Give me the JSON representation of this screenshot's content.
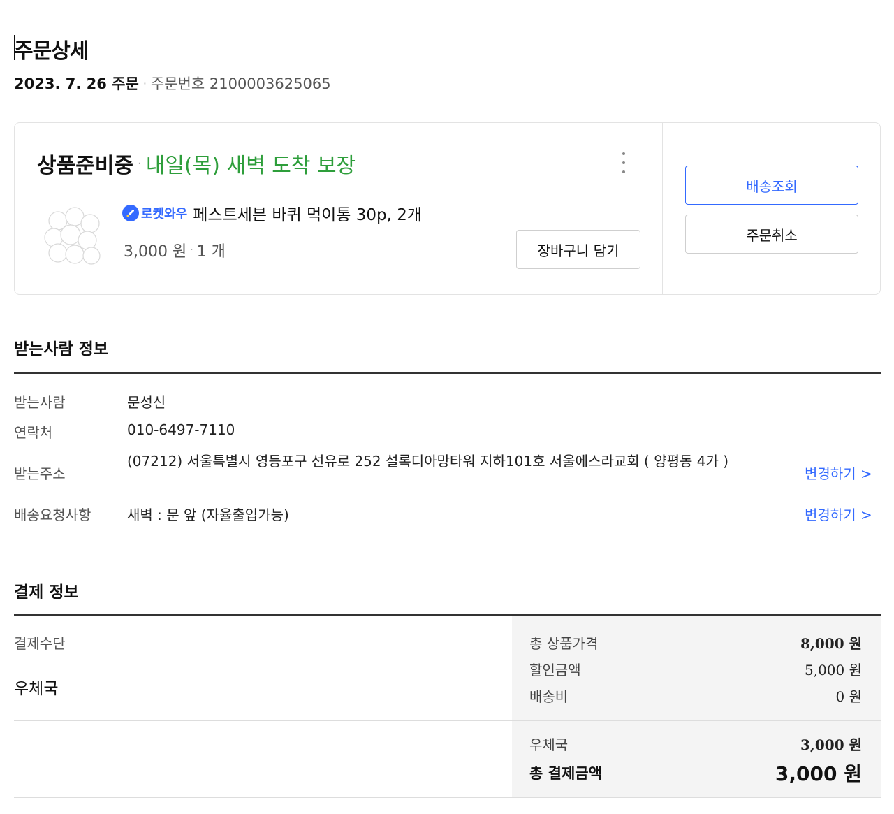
{
  "header": {
    "title": "주문상세",
    "order_date": "2023. 7. 26 주문",
    "separator": "·",
    "order_number": "주문번호 2100003625065"
  },
  "order_card": {
    "status": "상품준비중",
    "separator": "·",
    "delivery_promise": "내일(목) 새벽 도착 보장",
    "more_icon": "vertical-dots-icon",
    "product": {
      "image_icon": "cotton-balls-image",
      "badge_label": "로켓와우",
      "badge_icon": "rocket-icon",
      "name": "페스트세븐 바퀴 먹이통 30p, 2개",
      "price": "3,000 원",
      "separator": "·",
      "quantity": "1 개"
    },
    "cart_button": "장바구니 담기",
    "track_button": "배송조회",
    "cancel_button": "주문취소"
  },
  "recipient": {
    "section_title": "받는사람 정보",
    "name_label": "받는사람",
    "name": "문성신",
    "phone_label": "연락처",
    "phone": "010-6497-7110",
    "address_label": "받는주소",
    "address": "(07212) 서울특별시 영등포구 선유로 252 설록디아망타워 지하101호 서울에스라교회 ( 양평동 4가 )",
    "request_label": "배송요청사항",
    "request": "새벽 : 문 앞 (자율출입가능)",
    "change_address": "변경하기 >",
    "change_request": "변경하기 >"
  },
  "payment": {
    "section_title": "결제 정보",
    "method_label": "결제수단",
    "method": "우체국",
    "total_product_label": "총 상품가격",
    "total_product": "8,000 원",
    "discount_label": "할인금액",
    "discount": "5,000 원",
    "shipping_label": "배송비",
    "shipping": "0 원",
    "bank_label": "우체국",
    "bank_amount": "3,000 원",
    "grand_total_label": "총 결제금액",
    "grand_total": "3,000 원"
  },
  "colors": {
    "accent_blue": "#346aff",
    "delivery_green": "#2e9e3b"
  }
}
